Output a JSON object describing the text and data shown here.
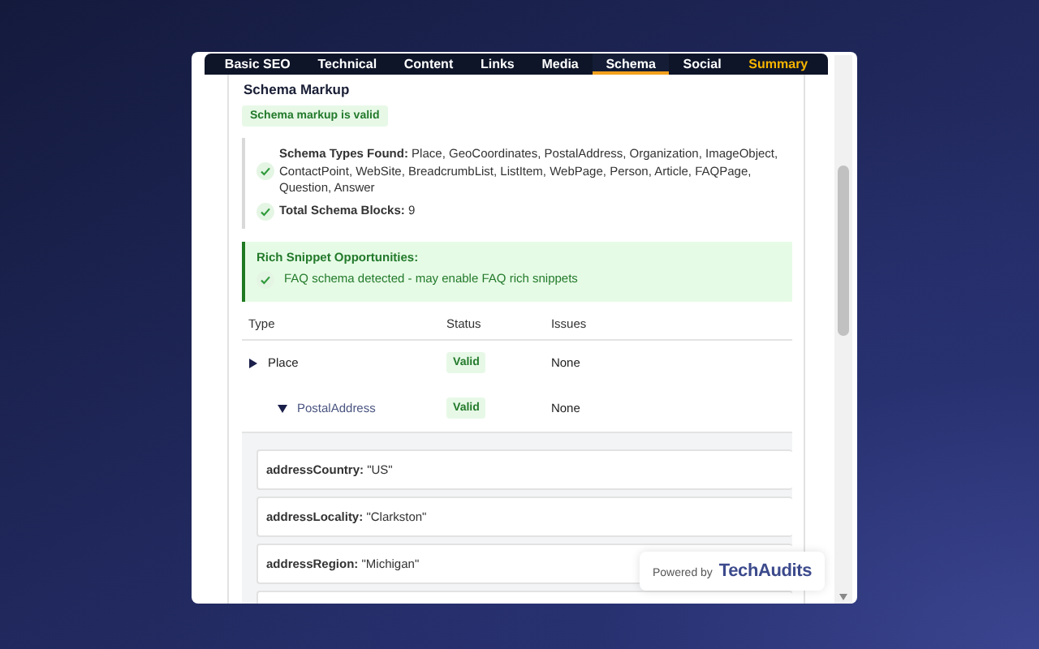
{
  "tabs": [
    {
      "label": "Basic SEO",
      "selected": false,
      "kind": "tab"
    },
    {
      "label": "Technical",
      "selected": false,
      "kind": "tab"
    },
    {
      "label": "Content",
      "selected": false,
      "kind": "tab"
    },
    {
      "label": "Links",
      "selected": false,
      "kind": "tab"
    },
    {
      "label": "Media",
      "selected": false,
      "kind": "tab"
    },
    {
      "label": "Schema",
      "selected": true,
      "kind": "tab"
    },
    {
      "label": "Social",
      "selected": false,
      "kind": "tab"
    },
    {
      "label": "Summary",
      "selected": false,
      "kind": "summary"
    }
  ],
  "section_title": "Schema Markup",
  "status_badge": "Schema markup is valid",
  "summary_items": [
    {
      "label": "Schema Types Found:",
      "value": "Place, GeoCoordinates, PostalAddress, Organization, ImageObject, ContactPoint, WebSite, BreadcrumbList, ListItem, WebPage, Person, Article, FAQPage, Question, Answer"
    },
    {
      "label": "Total Schema Blocks:",
      "value": "9"
    }
  ],
  "rich_snippets": {
    "title": "Rich Snippet Opportunities:",
    "items": [
      "FAQ schema detected - may enable FAQ rich snippets"
    ]
  },
  "table": {
    "columns": [
      "Type",
      "Status",
      "Issues"
    ],
    "rows": [
      {
        "type": "Place",
        "status": "Valid",
        "issues": "None",
        "expanded": false,
        "children": [
          {
            "type": "PostalAddress",
            "status": "Valid",
            "issues": "None",
            "expanded": true,
            "properties": [
              {
                "key": "addressCountry:",
                "value": "\"US\""
              },
              {
                "key": "addressLocality:",
                "value": "\"Clarkston\""
              },
              {
                "key": "addressRegion:",
                "value": "\"Michigan\""
              }
            ]
          }
        ]
      }
    ]
  },
  "powered_by": {
    "label": "Powered by",
    "brand": "TechAudits"
  }
}
